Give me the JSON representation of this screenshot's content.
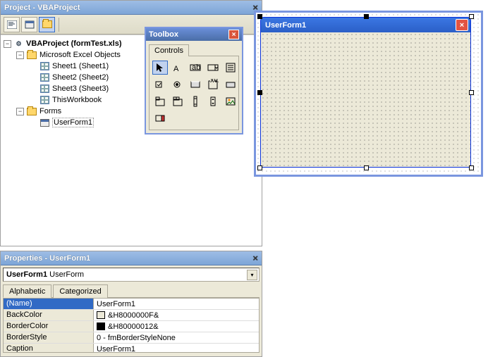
{
  "project": {
    "title": "Project - VBAProject",
    "root": "VBAProject (formTest.xls)",
    "group1": "Microsoft Excel Objects",
    "sheets": [
      "Sheet1 (Sheet1)",
      "Sheet2 (Sheet2)",
      "Sheet3 (Sheet3)"
    ],
    "workbook": "ThisWorkbook",
    "group2": "Forms",
    "form": "UserForm1"
  },
  "toolbox": {
    "title": "Toolbox",
    "tab": "Controls"
  },
  "userform": {
    "title": "UserForm1"
  },
  "props": {
    "title": "Properties - UserForm1",
    "selected_name": "UserForm1",
    "selected_type": "UserForm",
    "tabs": [
      "Alphabetic",
      "Categorized"
    ],
    "rows": [
      {
        "name": "(Name)",
        "value": "UserForm1",
        "selected": true
      },
      {
        "name": "BackColor",
        "value": "&H8000000F&",
        "swatch": "#ece9d8"
      },
      {
        "name": "BorderColor",
        "value": "&H80000012&",
        "swatch": "#000000"
      },
      {
        "name": "BorderStyle",
        "value": "0 - fmBorderStyleNone"
      },
      {
        "name": "Caption",
        "value": "UserForm1"
      }
    ]
  }
}
